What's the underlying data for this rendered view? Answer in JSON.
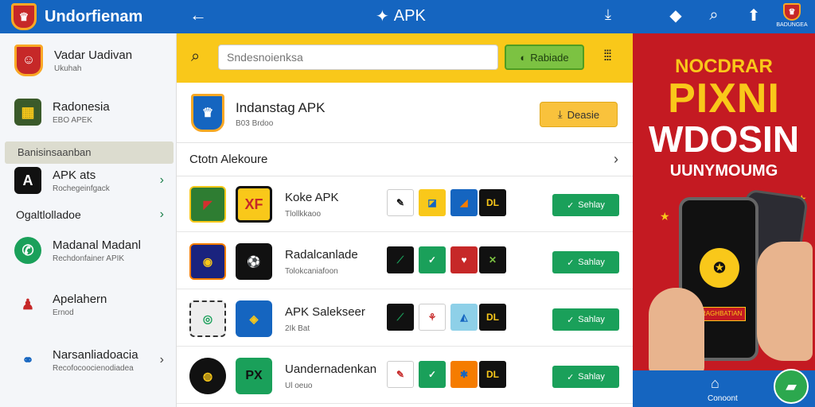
{
  "topbar": {
    "brand": "Undorfienam",
    "title": "APK",
    "avatar_label": "BADUNGEA"
  },
  "sidebar": {
    "user": {
      "name": "Vadar Uadivan",
      "sub": "Ukuhah"
    },
    "items": [
      {
        "label": "Radonesia",
        "sub": "EBO APEK"
      },
      {
        "label": "APK ats",
        "sub": "Rochegeinfgack"
      },
      {
        "label": "Ogaltlolladoe",
        "sub": ""
      },
      {
        "label": "Madanal Madanl",
        "sub": "Rechdonfainer APIK"
      },
      {
        "label": "Apelahern",
        "sub": "Ernod"
      },
      {
        "label": "Narsanliadoacia",
        "sub": "Recofocoocienodiadea"
      }
    ],
    "section_label": "Banisinsaanban"
  },
  "search": {
    "placeholder": "Sndesnoienksa",
    "button_label": "Rabiade"
  },
  "app": {
    "name": "Indanstag APK",
    "size": "B03 Brdoo",
    "download_label": "Deasie"
  },
  "category": {
    "label": "Ctotn Alekoure"
  },
  "rows": [
    {
      "name": "Koke APK",
      "size": "Tlollkkaoo",
      "button": "Sehlay"
    },
    {
      "name": "Radalcanlade",
      "size": "Tolokcaniafoon",
      "button": "Sahlay"
    },
    {
      "name": "APK Salekseer",
      "size": "2Ik Bat",
      "button": "Sahlay"
    },
    {
      "name": "Uandernadenkan",
      "size": "Ul oeuo",
      "button": "Sahlay"
    }
  ],
  "ad": {
    "line1": "NOCDRAR",
    "line2": "PIXNI",
    "line3": "WDOSIN",
    "line4": "UUNYMOUMG",
    "phone_label": "BRAGHBATIAN"
  },
  "bottom_nav": {
    "home_label": "Conoont"
  },
  "colors": {
    "primary": "#1565c0",
    "accent": "#f9c81a",
    "green": "#1aa05a",
    "ad_red": "#c41a22"
  }
}
